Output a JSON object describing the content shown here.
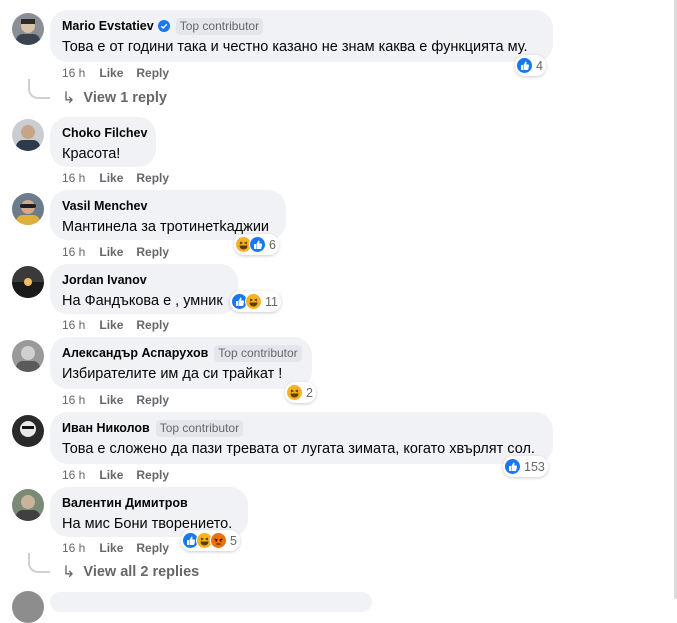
{
  "actions": {
    "like": "Like",
    "reply": "Reply"
  },
  "badge_label": "Top contributor",
  "comments": [
    {
      "name": "Mario Evstatiev",
      "verified": true,
      "badge": true,
      "text": "Това е от години така и честно казано не знам каква е функцията му.",
      "time": "16 h",
      "reactions": [
        "like"
      ],
      "reaction_count": "4"
    },
    {
      "name": "Choko Filchev",
      "verified": false,
      "badge": false,
      "text": "Красота!",
      "time": "16 h",
      "reactions": [],
      "reaction_count": ""
    },
    {
      "name": "Vasil Menchev",
      "verified": false,
      "badge": false,
      "text": "Мантинела за тротинетkаджии",
      "time": "16 h",
      "reactions": [
        "haha",
        "like"
      ],
      "reaction_count": "6"
    },
    {
      "name": "Jordan Ivanov",
      "verified": false,
      "badge": false,
      "text": "На Фандъкова е , умник",
      "time": "16 h",
      "reactions": [
        "like",
        "haha"
      ],
      "reaction_count": "11"
    },
    {
      "name": "Александър Аспарухов",
      "verified": false,
      "badge": true,
      "text": "Избирателите им да си трайкат !",
      "time": "16 h",
      "reactions": [
        "haha"
      ],
      "reaction_count": "2"
    },
    {
      "name": "Иван Николов",
      "verified": false,
      "badge": true,
      "text": "Това е сложено да пази тревата от лугата зимата, когато хвърлят сол.",
      "time": "16 h",
      "reactions": [
        "like"
      ],
      "reaction_count": "153"
    },
    {
      "name": "Валентин Димитров",
      "verified": false,
      "badge": false,
      "text": "На мис Бони творението.",
      "time": "16 h",
      "reactions": [
        "like",
        "haha",
        "angry"
      ],
      "reaction_count": "5"
    }
  ],
  "view_replies": [
    "View 1 reply",
    "View all 2 replies"
  ],
  "colors": {
    "like": "#1877f2",
    "haha": "#f7b125",
    "angry": "#e9710f",
    "bubble": "#f0f2f5",
    "meta": "#65676b"
  }
}
